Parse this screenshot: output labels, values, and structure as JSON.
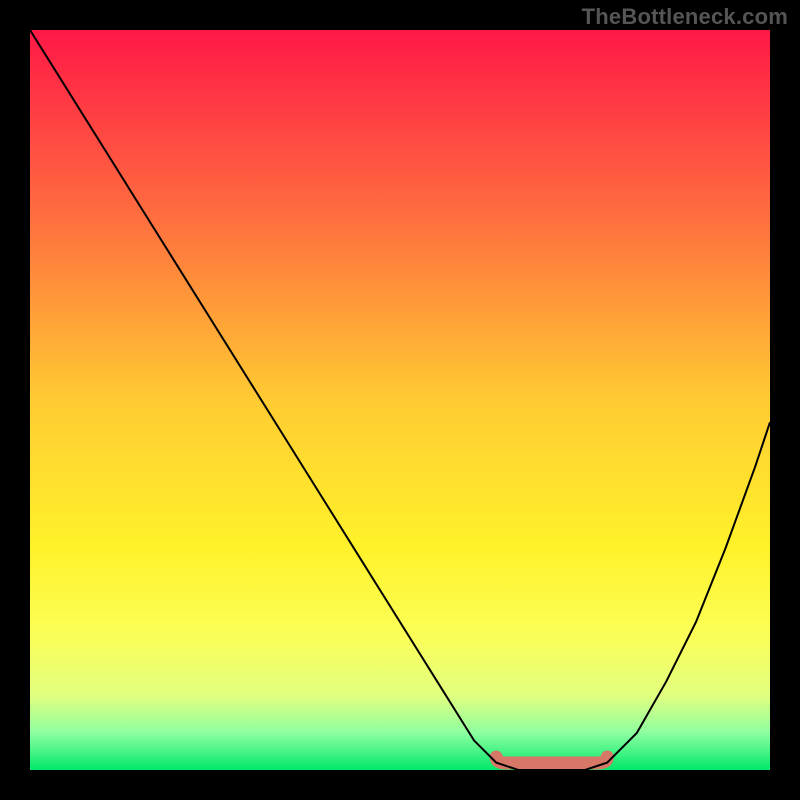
{
  "watermark": "TheBottleneck.com",
  "chart_data": {
    "type": "line",
    "title": "",
    "xlabel": "",
    "ylabel": "",
    "xlim": [
      0,
      100
    ],
    "ylim": [
      0,
      100
    ],
    "grid": false,
    "legend": false,
    "series": [
      {
        "name": "bottleneck-curve",
        "x": [
          0,
          5,
          10,
          15,
          20,
          25,
          30,
          35,
          40,
          45,
          50,
          55,
          60,
          63,
          66,
          69,
          72,
          75,
          78,
          82,
          86,
          90,
          94,
          98,
          100
        ],
        "y": [
          100,
          92,
          84,
          76,
          68,
          60,
          52,
          44,
          36,
          28,
          20,
          12,
          4,
          1,
          0,
          0,
          0,
          0,
          1,
          5,
          12,
          20,
          30,
          41,
          47
        ]
      }
    ],
    "marker": {
      "name": "optimal-zone",
      "x_range": [
        63,
        78
      ],
      "y": 0,
      "color": "#d77768"
    },
    "gradient_stops": [
      {
        "offset": 0.0,
        "color": "#ff1846"
      },
      {
        "offset": 0.25,
        "color": "#ff6d3f"
      },
      {
        "offset": 0.5,
        "color": "#ffcb32"
      },
      {
        "offset": 0.7,
        "color": "#fff22a"
      },
      {
        "offset": 0.82,
        "color": "#fbff58"
      },
      {
        "offset": 0.9,
        "color": "#e0ff80"
      },
      {
        "offset": 0.95,
        "color": "#8dffa0"
      },
      {
        "offset": 1.0,
        "color": "#00e86b"
      }
    ],
    "curve_color": "#000000",
    "curve_width": 2
  }
}
